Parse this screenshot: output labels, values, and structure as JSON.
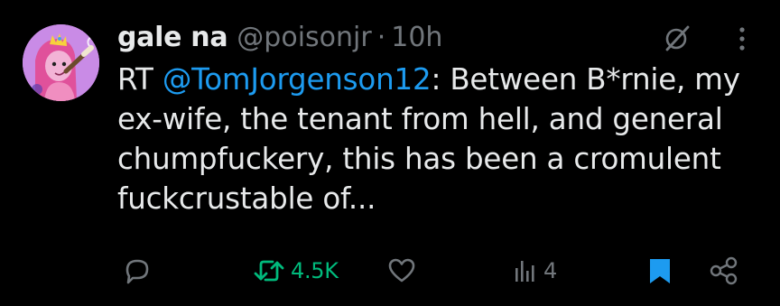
{
  "tweet": {
    "display_name": "gale na",
    "handle": "@poisonjr",
    "separator": "·",
    "time": "10h",
    "body": {
      "prefix": "RT ",
      "mention": "@TomJorgenson12",
      "text": ": Between B*rnie, my ex-wife, the tenant from hell, and general chumpfuckery, this has been a cromulent fuckcrustable of..."
    },
    "actions": {
      "reply_icon": "reply-icon",
      "retweet_count": "4.5K",
      "retweet_icon": "retweet-icon",
      "like_icon": "heart-icon",
      "views_count": "4",
      "views_icon": "views-icon",
      "bookmark_icon": "bookmark-icon",
      "share_icon": "share-icon"
    },
    "header_icons": [
      "grok-icon",
      "more-icon"
    ]
  },
  "colors": {
    "background": "#000000",
    "primary_text": "#e7e9ea",
    "secondary_text": "#71767b",
    "mention": "#1d9bf0",
    "retweet_active": "#00ba7c",
    "bookmark_active": "#1d9bf0",
    "avatar_bg": "#c98be6"
  }
}
